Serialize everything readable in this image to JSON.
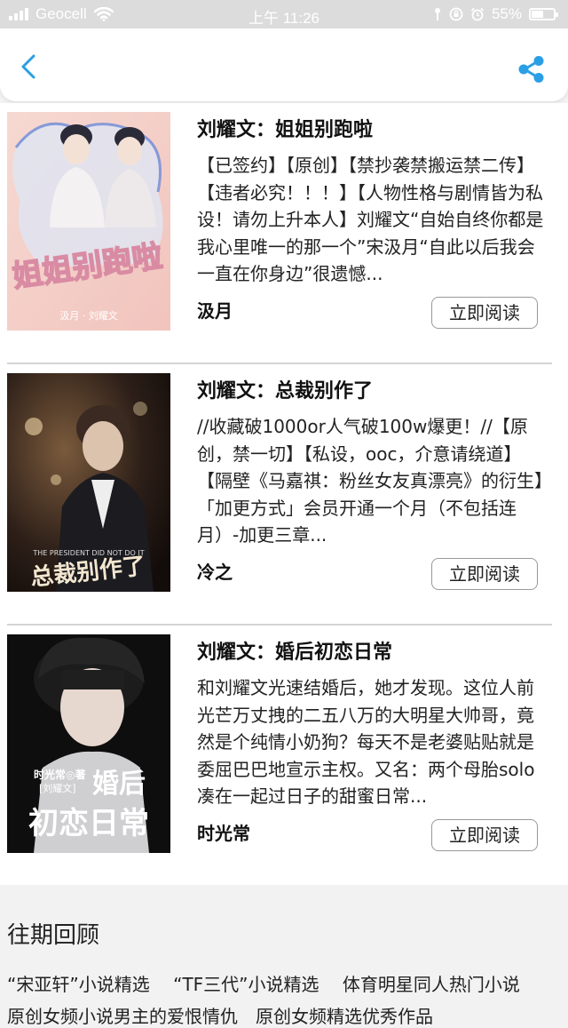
{
  "status": {
    "carrier": "Geocell",
    "time": "上午 11:26",
    "battery": "55%",
    "battery_level": 0.55
  },
  "nav": {
    "back_icon": "chevron-left-icon",
    "share_icon": "share-icon",
    "accent": "#2a9fe6"
  },
  "items": [
    {
      "title": "刘耀文：姐姐别跑啦",
      "desc": "【已签约】【原创】【禁抄袭禁搬运禁二传】【违者必究！！！】【人物性格与剧情皆为私设！请勿上升本人】刘耀文“自始自终你都是我心里唯一的那一个”宋汲月“自此以后我会一直在你身边”很遗憾...",
      "author": "汲月",
      "button": "立即阅读",
      "cover_title": "姐姐别跑啦",
      "cover_credits": "汲月 · 刘耀文"
    },
    {
      "title": "刘耀文：总裁别作了",
      "desc": "//收藏破1000or人气破100w爆更！//【原创，禁一切】【私设，ooc，介意请绕道】【隔壁《马嘉祺：粉丝女友真漂亮》的衍生】「加更方式」会员开通一个月（不包括连月）-加更三章...",
      "author": "冷之",
      "button": "立即阅读",
      "cover_title": "总裁别作了",
      "cover_subtitle": "THE PRESIDENT DID NOT DO IT"
    },
    {
      "title": "刘耀文：婚后初恋日常",
      "desc": "和刘耀文光速结婚后，她才发现。这位人前光芒万丈拽的二五八万的大明星大帅哥，竟然是个纯情小奶狗？每天不是老婆贴贴就是委屈巴巴地宣示主权。又名：两个母胎solo凑在一起过日子的甜蜜日常...",
      "author": "时光常",
      "button": "立即阅读",
      "cover_title_1": "婚后",
      "cover_title_2": "初恋日常",
      "cover_byline": "时光常◎著",
      "cover_name": "[刘耀文]"
    }
  ],
  "past": {
    "title": "往期回顾",
    "links": [
      "“宋亚轩”小说精选",
      "“TF三代”小说精选",
      "体育明星同人热门小说"
    ],
    "links_row2": "原创女频小说男主的爱恨情仇　原创女频精选优秀作品"
  }
}
